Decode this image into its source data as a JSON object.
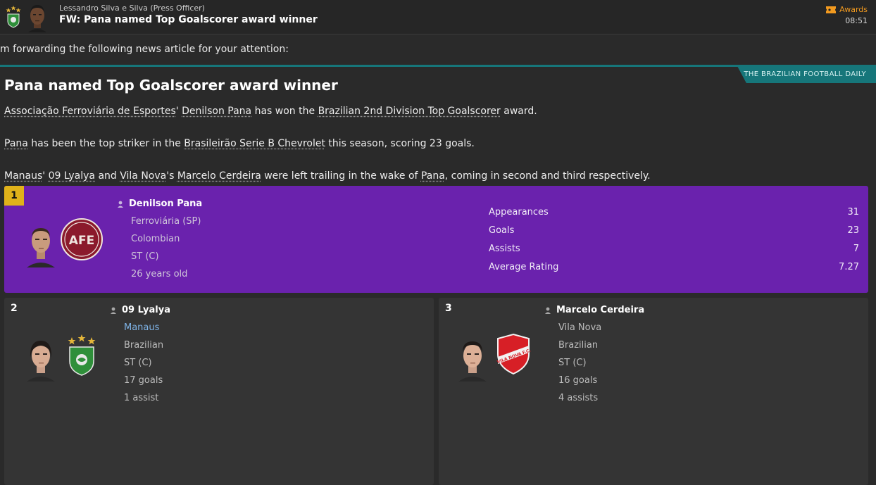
{
  "message": {
    "sender": "Lessandro Silva e Silva  (Press Officer)",
    "subject": "FW: Pana named Top Goalscorer award winner",
    "category": "Awards",
    "time": "08:51"
  },
  "intro": "m forwarding the following news article for your attention:",
  "article": {
    "publication": "THE BRAZILIAN FOOTBALL DAILY",
    "headline": "Pana named Top Goalscorer award winner",
    "p1": {
      "club": "Associação Ferroviária de Esportes",
      "t1": "' ",
      "player": "Denilson Pana",
      "t2": " has won the ",
      "award": "Brazilian 2nd Division Top Goalscorer",
      "t3": " award."
    },
    "p2": {
      "player": "Pana",
      "t1": " has been the top striker in the ",
      "league": "Brasileirão Serie B Chevrolet",
      "t2": " this season, scoring 23 goals."
    },
    "p3": {
      "club1": "Manaus",
      "t1": "' ",
      "player1": "09 Lyalya",
      "t2": " and ",
      "club2": "Vila Nova",
      "t3": "'s ",
      "player2": "Marcelo Cerdeira",
      "t4": " were left trailing in the wake of ",
      "player3": "Pana",
      "t5": ", coming in second and third respectively."
    }
  },
  "winners": [
    {
      "rank": "1",
      "name": "Denilson Pana",
      "club": "Ferroviária (SP)",
      "nationality": "Colombian",
      "position": "ST (C)",
      "age": "26 years old",
      "stats": [
        {
          "label": "Appearances",
          "value": "31"
        },
        {
          "label": "Goals",
          "value": "23"
        },
        {
          "label": "Assists",
          "value": "7"
        },
        {
          "label": "Average Rating",
          "value": "7.27"
        }
      ]
    },
    {
      "rank": "2",
      "name": "09 Lyalya",
      "club": "Manaus",
      "nationality": "Brazilian",
      "position": "ST (C)",
      "goals": "17 goals",
      "assists": "1 assist"
    },
    {
      "rank": "3",
      "name": "Marcelo Cerdeira",
      "club": "Vila Nova",
      "nationality": "Brazilian",
      "position": "ST (C)",
      "goals": "16 goals",
      "assists": "4 assists"
    }
  ],
  "crests": {
    "ferroviaria": "AFE",
    "vila_nova": "VILA NOVA F.C."
  },
  "colors": {
    "winner_card": "#6a22ad",
    "rank_gold": "#e0b21a",
    "publication_teal": "#16767a",
    "awards_orange": "#f29a1f"
  }
}
